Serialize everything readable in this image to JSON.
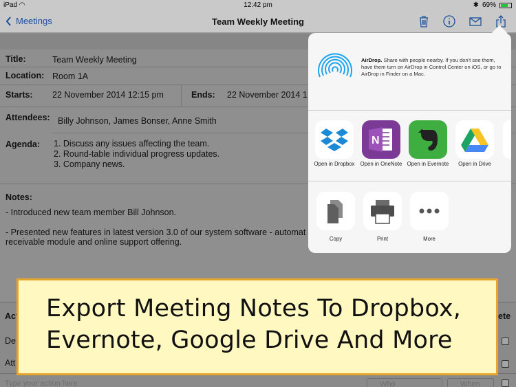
{
  "status_bar": {
    "device": "iPad",
    "time": "12:42 pm",
    "battery": "69%",
    "battery_level": 0.69
  },
  "nav": {
    "back_label": "Meetings",
    "title": "Team Weekly Meeting"
  },
  "form": {
    "title_label": "Title:",
    "title_value": "Team Weekly Meeting",
    "location_label": "Location:",
    "location_value": "Room 1A",
    "starts_label": "Starts:",
    "starts_value": "22 November 2014 12:15 pm",
    "ends_label": "Ends:",
    "ends_value": "22 November 2014 1",
    "attendees_label": "Attendees:",
    "attendees_value": "Billy Johnson, James Bonser, Anne Smith",
    "agenda_label": "Agenda:",
    "agenda_items": [
      "1. Discuss any issues affecting the team.",
      "2. Round-table individual progress updates.",
      "3. Company news."
    ],
    "notes_label": "Notes:",
    "notes_lines": [
      "- Introduced new team member Bill Johnson.",
      "- Presented new features in latest version 3.0 of our system software - automat",
      "receivable module and online support offering."
    ]
  },
  "actions_table": {
    "header_left": "Act",
    "header_right": "ete",
    "row1_partial": "De",
    "row2_partial": "Att",
    "action_placeholder": "Type your action here",
    "who_placeholder": "Who",
    "when_placeholder": "When"
  },
  "share_sheet": {
    "airdrop_title": "AirDrop.",
    "airdrop_desc": "Share with people nearby. If you don't see them, have them turn on AirDrop in Control Center on iOS, or go to AirDrop in Finder on a Mac.",
    "apps": [
      {
        "label": "Open in Dropbox",
        "icon": "dropbox-icon"
      },
      {
        "label": "Open in OneNote",
        "icon": "onenote-icon"
      },
      {
        "label": "Open in Evernote",
        "icon": "evernote-icon"
      },
      {
        "label": "Open in Drive",
        "icon": "google-drive-icon"
      }
    ],
    "actions": [
      {
        "label": "Copy",
        "icon": "copy-icon"
      },
      {
        "label": "Print",
        "icon": "printer-icon"
      },
      {
        "label": "More",
        "icon": "more-icon"
      }
    ]
  },
  "banner": {
    "line1": "Export Meeting Notes To Dropbox,",
    "line2": "Evernote, Google Drive And More"
  },
  "colors": {
    "accent": "#1c4f9a",
    "banner_bg": "#fff8c1",
    "banner_border": "#e7a52c"
  }
}
